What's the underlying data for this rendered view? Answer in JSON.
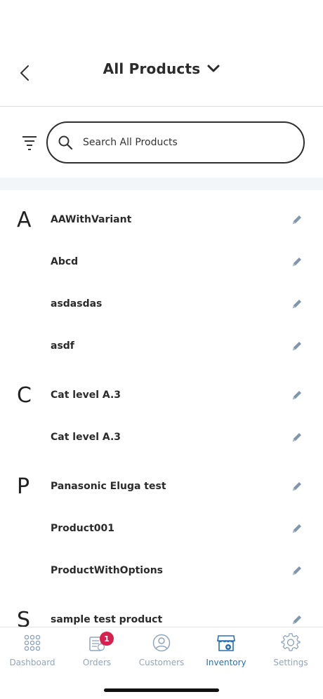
{
  "header": {
    "title": "All Products"
  },
  "search": {
    "placeholder": "Search All Products"
  },
  "sections": [
    {
      "letter": "A",
      "items": [
        "AAWithVariant",
        "Abcd",
        "asdasdas",
        "asdf"
      ]
    },
    {
      "letter": "C",
      "items": [
        "Cat level A.3",
        "Cat level A.3"
      ]
    },
    {
      "letter": "P",
      "items": [
        "Panasonic Eluga test",
        "Product001",
        "ProductWithOptions"
      ]
    },
    {
      "letter": "S",
      "items": [
        "sample test product"
      ]
    }
  ],
  "tabs": [
    {
      "label": "Dashboard",
      "icon": "dashboard-grid-icon",
      "active": false
    },
    {
      "label": "Orders",
      "icon": "orders-icon",
      "active": false,
      "badge": "1"
    },
    {
      "label": "Customers",
      "icon": "customers-icon",
      "active": false
    },
    {
      "label": "Inventory",
      "icon": "inventory-store-icon",
      "active": true
    },
    {
      "label": "Settings",
      "icon": "settings-gear-icon",
      "active": false
    }
  ],
  "colors": {
    "accent": "#2a6fb3",
    "inactive_tab": "#8fa6bd",
    "badge": "#d6204d",
    "edit_icon": "#7f96ab",
    "band": "#f3f6f9"
  }
}
